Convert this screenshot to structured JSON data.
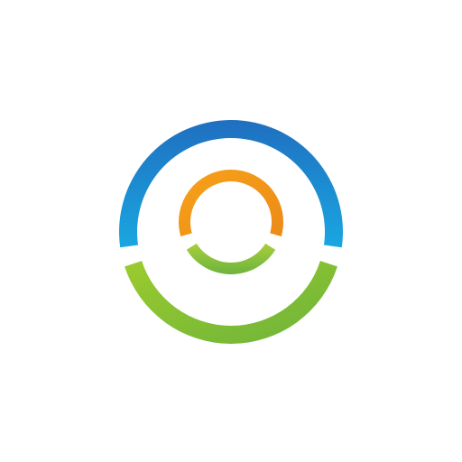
{
  "logo": {
    "icon": "concentric-ring-logo-icon",
    "colors": {
      "background": "#ffffff",
      "outer_top_arc_light": "#1aa7e1",
      "outer_top_arc_dark": "#1f6fc0",
      "outer_bottom_arc_light": "#9ccb2e",
      "outer_bottom_arc_dark": "#6cb33a",
      "inner_top_arc_light": "#f7a21a",
      "inner_top_arc_dark": "#ec8a17",
      "inner_bottom_arc_light": "#a8cf3a",
      "inner_bottom_arc_dark": "#6db33f"
    }
  }
}
